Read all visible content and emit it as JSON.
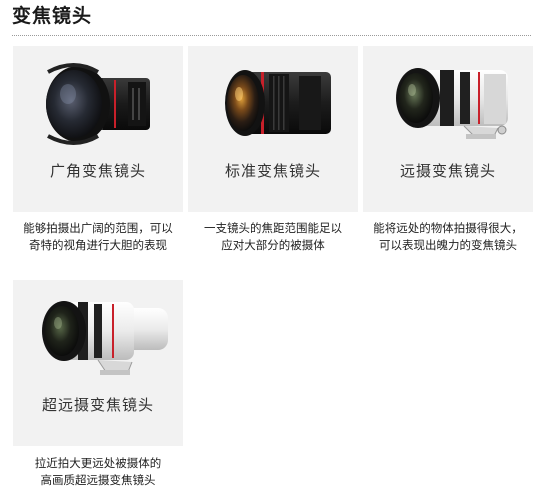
{
  "section": {
    "title": "变焦镜头"
  },
  "lenses": [
    {
      "name": "广角变焦镜头",
      "description_lines": [
        "能够拍摄出广阔的范围，可以",
        "奇特的视角进行大胆的表现"
      ]
    },
    {
      "name": "标准变焦镜头",
      "description_lines": [
        "一支镜头的焦距范围能足以",
        "应对大部分的被摄体"
      ]
    },
    {
      "name": "远摄变焦镜头",
      "description_lines": [
        "能将远处的物体拍摄得很大，",
        "可以表现出魄力的变焦镜头"
      ]
    },
    {
      "name": "超远摄变焦镜头",
      "description_lines": [
        "拉近拍大更远处被摄体的",
        "高画质超远摄变焦镜头"
      ]
    }
  ],
  "colors": {
    "card_background": "#f2f2f2",
    "lens_red_ring": "#c8202a",
    "lens_body_black": "#1b1b1b",
    "lens_body_white": "#ececec"
  }
}
